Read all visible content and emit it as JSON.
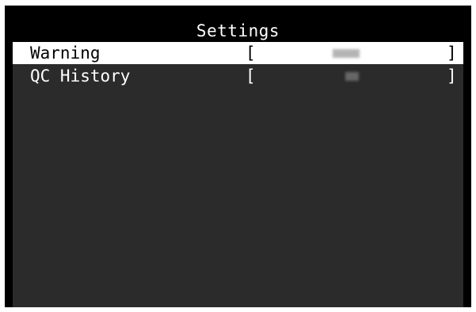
{
  "osd": {
    "title": "Settings",
    "items": [
      {
        "label": "Warning",
        "bracket_open": "[",
        "bracket_close": "]",
        "selected": true,
        "value_obscured": true
      },
      {
        "label": "QC History",
        "bracket_open": "[",
        "bracket_close": "]",
        "selected": false,
        "value_obscured": true
      }
    ]
  },
  "colors": {
    "frame": "#000000",
    "panel": "#2b2b2b",
    "selected_bg": "#ffffff",
    "selected_text": "#000000",
    "text": "#ffffff"
  }
}
